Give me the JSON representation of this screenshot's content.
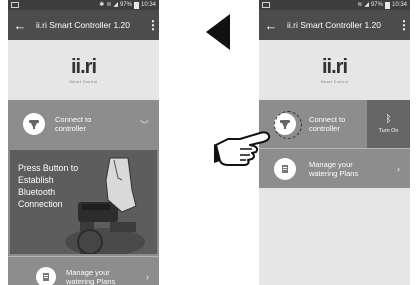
{
  "status_bar": {
    "time": "10:34",
    "battery": "97%"
  },
  "app": {
    "title": "ii.ri Smart Controller 1.20"
  },
  "logo": {
    "text": "ii.ri",
    "sub": "Smart Control"
  },
  "connect_row": {
    "label_line1": "Connect to",
    "label_line2": "controller"
  },
  "instruction": {
    "line1": "Press Button to",
    "line2": "Establish",
    "line3": "Bluetooth",
    "line4": "Connection"
  },
  "plans_row": {
    "label_line1": "Manage your",
    "label_line2": "watering Plans"
  },
  "bluetooth_tile": {
    "label": "Turn On"
  },
  "colors": {
    "appbar": "#4c4c4c",
    "statusbar": "#3e3e3e",
    "row_gray": "#8d8d8d",
    "row_dark": "#666666"
  }
}
